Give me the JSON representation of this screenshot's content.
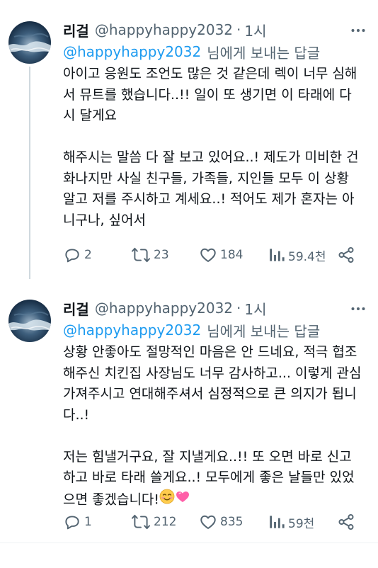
{
  "tweets": [
    {
      "author_name": "리걸",
      "handle": "@happyhappy2032",
      "separator": "·",
      "time": "1시",
      "reply_to_mention": "@happyhappy2032",
      "reply_to_suffix": "님에게 보내는 답글",
      "paragraphs": [
        "아이고 응원도 조언도 많은 것 같은데 렉이 너무 심해서 뮤트를 했습니다..!! 일이 또 생기면 이 타래에 다시 달게요",
        "해주시는 말씀 다 잘 보고 있어요..! 제도가 미비한 건 화나지만 사실 친구들, 가족들, 지인들 모두 이 상황 알고 저를 주시하고 계세요..! 적어도 제가 혼자는 아니구나, 싶어서"
      ],
      "replies": "2",
      "retweets": "23",
      "likes": "184",
      "views": "59.4천"
    },
    {
      "author_name": "리걸",
      "handle": "@happyhappy2032",
      "separator": "·",
      "time": "1시",
      "reply_to_mention": "@happyhappy2032",
      "reply_to_suffix": "님에게 보내는 답글",
      "paragraphs": [
        "상황 안좋아도 절망적인 마음은 안 드네요, 적극 협조해주신 치킨집 사장님도 너무 감사하고... 이렇게 관심 가져주시고 연대해주셔서 심정적으로 큰 의지가 됩니다..!",
        "저는 힘낼거구요, 잘 지낼게요..!! 또 오면 바로 신고하고 바로 타래 쓸게요..! 모두에게 좋은 날들만 있었으면 좋겠습니다!"
      ],
      "emojis": [
        "smiling-face-emoji",
        "pink-heart-emoji"
      ],
      "replies": "1",
      "retweets": "212",
      "likes": "835",
      "views": "59천"
    }
  ],
  "icons": {
    "more": "more-icon",
    "reply": "reply-icon",
    "retweet": "retweet-icon",
    "like": "heart-icon",
    "views": "views-icon",
    "share": "share-icon"
  },
  "colors": {
    "text": "#0f1419",
    "secondary": "#536471",
    "accent": "#1d9bf0",
    "divider": "#eff3f4"
  }
}
